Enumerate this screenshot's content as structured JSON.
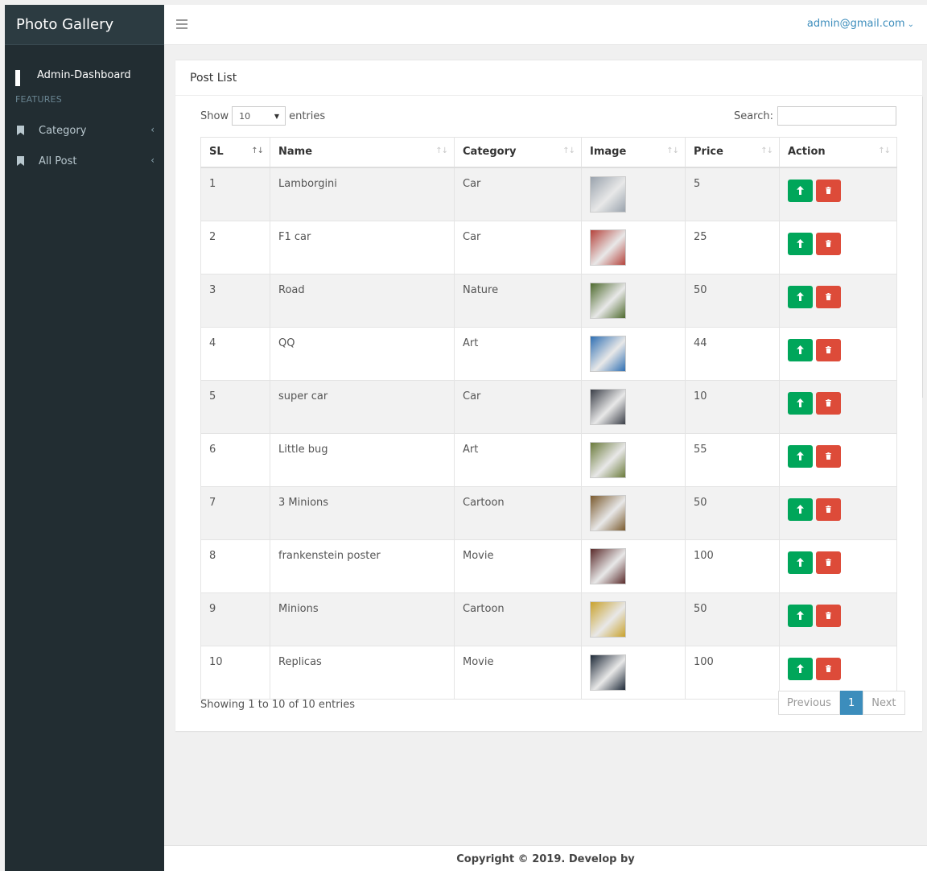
{
  "sidebar": {
    "brand": "Photo Gallery",
    "dashboard_label": "Admin-Dashboard",
    "section_header": "FEATURES",
    "items": [
      {
        "label": "Category",
        "icon": "bookmark-icon"
      },
      {
        "label": "All Post",
        "icon": "bookmark-icon"
      }
    ]
  },
  "header": {
    "user_email": "admin@gmail.com"
  },
  "box": {
    "title": "Post List"
  },
  "controls": {
    "show_label": "Show",
    "entries_value": "10",
    "entries_label": "entries",
    "search_label": "Search:",
    "search_value": ""
  },
  "table": {
    "columns": [
      "SL",
      "Name",
      "Category",
      "Image",
      "Price",
      "Action"
    ],
    "rows": [
      {
        "sl": "1",
        "name": "Lamborgini",
        "category": "Car",
        "price": "5",
        "thumb": "#9aa3ad"
      },
      {
        "sl": "2",
        "name": "F1 car",
        "category": "Car",
        "price": "25",
        "thumb": "#b5433c"
      },
      {
        "sl": "3",
        "name": "Road",
        "category": "Nature",
        "price": "50",
        "thumb": "#4e6a2e"
      },
      {
        "sl": "4",
        "name": "QQ",
        "category": "Art",
        "price": "44",
        "thumb": "#2f6fb3"
      },
      {
        "sl": "5",
        "name": "super car",
        "category": "Car",
        "price": "10",
        "thumb": "#3b3f48"
      },
      {
        "sl": "6",
        "name": "Little bug",
        "category": "Art",
        "price": "55",
        "thumb": "#6a7a3a"
      },
      {
        "sl": "7",
        "name": "3 Minions",
        "category": "Cartoon",
        "price": "50",
        "thumb": "#7a5a2e"
      },
      {
        "sl": "8",
        "name": "frankenstein poster",
        "category": "Movie",
        "price": "100",
        "thumb": "#5a2b2b"
      },
      {
        "sl": "9",
        "name": "Minions",
        "category": "Cartoon",
        "price": "50",
        "thumb": "#c9a22c"
      },
      {
        "sl": "10",
        "name": "Replicas",
        "category": "Movie",
        "price": "100",
        "thumb": "#1e2a38"
      }
    ]
  },
  "info_text": "Showing 1 to 10 of 10 entries",
  "pagination": {
    "previous": "Previous",
    "current": "1",
    "next": "Next"
  },
  "footer": {
    "text": "Copyright ©  2019. Develop by"
  },
  "colors": {
    "primary": "#3c8dbc",
    "success": "#00a65a",
    "danger": "#dd4b39",
    "sidebar_bg": "#222d32"
  }
}
